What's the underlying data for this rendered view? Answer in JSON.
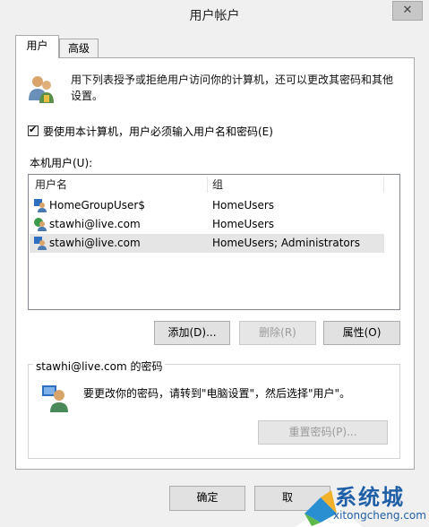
{
  "window": {
    "title": "用户帐户",
    "close_glyph": "✕"
  },
  "tabs": [
    {
      "label": "用户"
    },
    {
      "label": "高级"
    }
  ],
  "intro": {
    "text": "用下列表授予或拒绝用户访问你的计算机，还可以更改其密码和其他设置。"
  },
  "require_login": {
    "checked": true,
    "check_glyph": "✔",
    "label": "要使用本计算机，用户必须输入用户名和密码(E)"
  },
  "local_users": {
    "label": "本机用户(U):",
    "columns": [
      "用户名",
      "组"
    ],
    "rows": [
      {
        "name": "HomeGroupUser$",
        "group": "HomeUsers",
        "icon": "user-group-icon",
        "selected": false
      },
      {
        "name": "stawhi@live.com",
        "group": "HomeUsers",
        "icon": "user-online-icon",
        "selected": false
      },
      {
        "name": "stawhi@live.com",
        "group": "HomeUsers; Administrators",
        "icon": "user-group-icon",
        "selected": true
      }
    ]
  },
  "buttons": {
    "add": "添加(D)...",
    "remove": "删除(R)",
    "properties": "属性(O)",
    "reset_password": "重置密码(P)...",
    "ok": "确定",
    "cancel": "取"
  },
  "password_group": {
    "title": "stawhi@live.com 的密码",
    "text": "要更改你的密码，请转到\"电脑设置\"，然后选择\"用户\"。"
  },
  "watermark": {
    "text": "系统城",
    "url": "xitongcheng.com"
  },
  "colors": {
    "selection": "#e5e5e5",
    "watermark": "#1f5fa8"
  }
}
